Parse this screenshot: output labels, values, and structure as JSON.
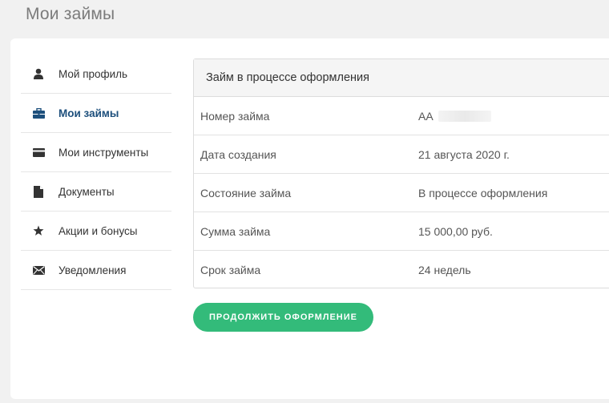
{
  "page": {
    "title": "Мои займы"
  },
  "sidebar": {
    "items": [
      {
        "label": "Мой профиль",
        "icon": "user-icon"
      },
      {
        "label": "Мои займы",
        "icon": "briefcase-icon",
        "active": true
      },
      {
        "label": "Мои инструменты",
        "icon": "credit-card-icon"
      },
      {
        "label": "Документы",
        "icon": "document-icon"
      },
      {
        "label": "Акции и бонусы",
        "icon": "star-icon"
      },
      {
        "label": "Уведомления",
        "icon": "envelope-icon"
      }
    ]
  },
  "loan": {
    "header": "Займ в процессе оформления",
    "rows": [
      {
        "key": "Номер займа",
        "value": "АА"
      },
      {
        "key": "Дата создания",
        "value": "21 августа 2020 г."
      },
      {
        "key": "Состояние займа",
        "value": "В процессе оформления"
      },
      {
        "key": "Сумма займа",
        "value": "15 000,00 руб."
      },
      {
        "key": "Срок займа",
        "value": "24 недель"
      }
    ]
  },
  "actions": {
    "continue_label": "ПРОДОЛЖИТЬ ОФОРМЛЕНИЕ"
  },
  "colors": {
    "accent": "#1d4f7c",
    "button": "#33bb7a",
    "background": "#f1f1f1"
  }
}
